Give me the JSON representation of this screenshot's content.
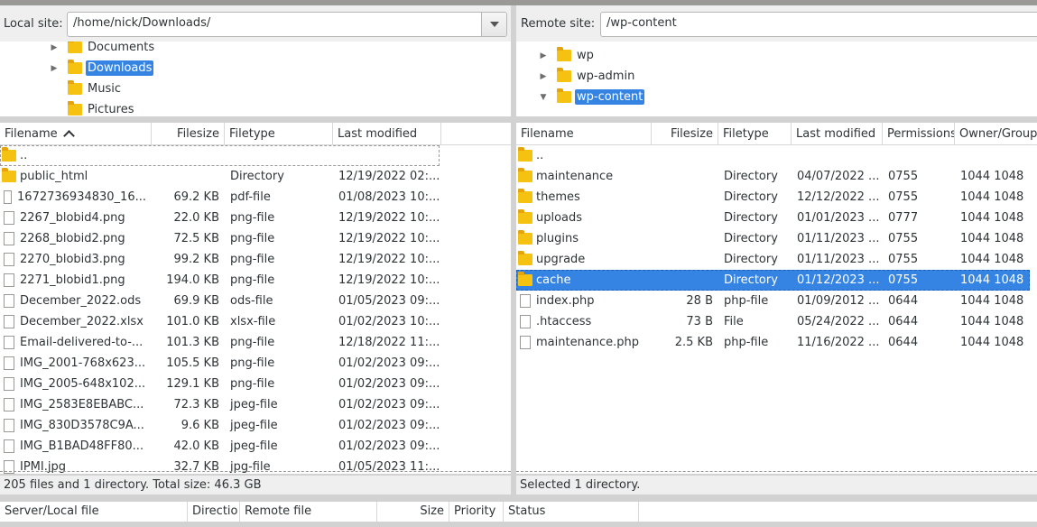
{
  "local": {
    "site_label": "Local site:",
    "site_path": "/home/nick/Downloads/",
    "tree": [
      {
        "label": "Documents",
        "expander": "right",
        "selected": false
      },
      {
        "label": "Downloads",
        "expander": "right",
        "selected": true
      },
      {
        "label": "Music",
        "expander": "",
        "selected": false
      },
      {
        "label": "Pictures",
        "expander": "",
        "selected": false
      }
    ],
    "columns": [
      "Filename",
      "Filesize",
      "Filetype",
      "Last modified"
    ],
    "files": [
      {
        "name": "..",
        "size": "",
        "type": "",
        "modified": "",
        "icon": "folder"
      },
      {
        "name": "public_html",
        "size": "",
        "type": "Directory",
        "modified": "12/19/2022 02:...",
        "icon": "folder"
      },
      {
        "name": "1672736934830_16...",
        "size": "69.2 KB",
        "type": "pdf-file",
        "modified": "01/08/2023 10:...",
        "icon": "file"
      },
      {
        "name": "2267_blobid4.png",
        "size": "22.0 KB",
        "type": "png-file",
        "modified": "12/19/2022 10:...",
        "icon": "file"
      },
      {
        "name": "2268_blobid2.png",
        "size": "72.5 KB",
        "type": "png-file",
        "modified": "12/19/2022 10:...",
        "icon": "file"
      },
      {
        "name": "2270_blobid3.png",
        "size": "99.2 KB",
        "type": "png-file",
        "modified": "12/19/2022 10:...",
        "icon": "file"
      },
      {
        "name": "2271_blobid1.png",
        "size": "194.0 KB",
        "type": "png-file",
        "modified": "12/19/2022 10:...",
        "icon": "file"
      },
      {
        "name": "December_2022.ods",
        "size": "69.9 KB",
        "type": "ods-file",
        "modified": "01/05/2023 09:...",
        "icon": "file"
      },
      {
        "name": "December_2022.xlsx",
        "size": "101.0 KB",
        "type": "xlsx-file",
        "modified": "01/02/2023 10:...",
        "icon": "file"
      },
      {
        "name": "Email-delivered-to-...",
        "size": "101.3 KB",
        "type": "png-file",
        "modified": "12/18/2022 11:...",
        "icon": "file"
      },
      {
        "name": "IMG_2001-768x623...",
        "size": "105.5 KB",
        "type": "png-file",
        "modified": "01/02/2023 09:...",
        "icon": "file"
      },
      {
        "name": "IMG_2005-648x102...",
        "size": "129.1 KB",
        "type": "png-file",
        "modified": "01/02/2023 09:...",
        "icon": "file"
      },
      {
        "name": "IMG_2583E8EBABC...",
        "size": "72.3 KB",
        "type": "jpeg-file",
        "modified": "01/02/2023 09:...",
        "icon": "file"
      },
      {
        "name": "IMG_830D3578C9A...",
        "size": "9.6 KB",
        "type": "jpeg-file",
        "modified": "01/02/2023 09:...",
        "icon": "file"
      },
      {
        "name": "IMG_B1BAD48FF80...",
        "size": "42.0 KB",
        "type": "jpeg-file",
        "modified": "01/02/2023 09:...",
        "icon": "file"
      },
      {
        "name": "IPMI.jpg",
        "size": "32.7 KB",
        "type": "jpg-file",
        "modified": "01/05/2023 11:...",
        "icon": "file"
      }
    ],
    "status": "205 files and 1 directory. Total size: 46.3 GB"
  },
  "remote": {
    "site_label": "Remote site:",
    "site_path": "/wp-content",
    "tree": [
      {
        "label": "wp",
        "expander": "right",
        "selected": false
      },
      {
        "label": "wp-admin",
        "expander": "right",
        "selected": false
      },
      {
        "label": "wp-content",
        "expander": "down",
        "selected": true
      }
    ],
    "columns": [
      "Filename",
      "Filesize",
      "Filetype",
      "Last modified",
      "Permissions",
      "Owner/Group"
    ],
    "files": [
      {
        "name": "..",
        "size": "",
        "type": "",
        "modified": "",
        "perms": "",
        "owner": "",
        "icon": "folder",
        "selected": false
      },
      {
        "name": "maintenance",
        "size": "",
        "type": "Directory",
        "modified": "04/07/2022 ...",
        "perms": "0755",
        "owner": "1044 1048",
        "icon": "folder",
        "selected": false
      },
      {
        "name": "themes",
        "size": "",
        "type": "Directory",
        "modified": "12/12/2022 ...",
        "perms": "0755",
        "owner": "1044 1048",
        "icon": "folder",
        "selected": false
      },
      {
        "name": "uploads",
        "size": "",
        "type": "Directory",
        "modified": "01/01/2023 ...",
        "perms": "0777",
        "owner": "1044 1048",
        "icon": "folder",
        "selected": false
      },
      {
        "name": "plugins",
        "size": "",
        "type": "Directory",
        "modified": "01/11/2023 ...",
        "perms": "0755",
        "owner": "1044 1048",
        "icon": "folder",
        "selected": false
      },
      {
        "name": "upgrade",
        "size": "",
        "type": "Directory",
        "modified": "01/11/2023 ...",
        "perms": "0755",
        "owner": "1044 1048",
        "icon": "folder",
        "selected": false
      },
      {
        "name": "cache",
        "size": "",
        "type": "Directory",
        "modified": "01/12/2023 ...",
        "perms": "0755",
        "owner": "1044 1048",
        "icon": "folder",
        "selected": true
      },
      {
        "name": "index.php",
        "size": "28 B",
        "type": "php-file",
        "modified": "01/09/2012 ...",
        "perms": "0644",
        "owner": "1044 1048",
        "icon": "file",
        "selected": false
      },
      {
        "name": ".htaccess",
        "size": "73 B",
        "type": "File",
        "modified": "05/24/2022 ...",
        "perms": "0644",
        "owner": "1044 1048",
        "icon": "file",
        "selected": false
      },
      {
        "name": "maintenance.php",
        "size": "2.5 KB",
        "type": "php-file",
        "modified": "11/16/2022 ...",
        "perms": "0644",
        "owner": "1044 1048",
        "icon": "file",
        "selected": false
      }
    ],
    "status": "Selected 1 directory."
  },
  "queue": {
    "columns": [
      "Server/Local file",
      "Directio",
      "Remote file",
      "Size",
      "Priority",
      "Status"
    ]
  },
  "colors": {
    "selection": "#3584e4",
    "folder": "#f5c211"
  }
}
